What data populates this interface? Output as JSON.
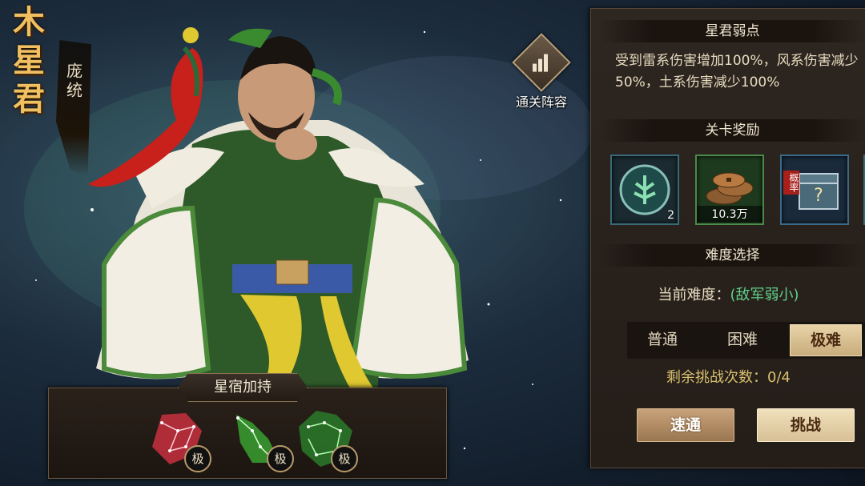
{
  "boss": {
    "title_chars": [
      "木",
      "星",
      "君"
    ],
    "hero_name": "庞统"
  },
  "formation": {
    "label": "通关阵容",
    "icon": "bar-chart-icon"
  },
  "panel": {
    "weakness_header": "星君弱点",
    "weakness_text": "受到雷系伤害增加100%，风系伤害减少50%，土系伤害减少100%",
    "rewards_header": "关卡奖励",
    "rewards": [
      {
        "icon": "tree-rune-icon",
        "count": "2"
      },
      {
        "icon": "copper-coins-icon",
        "count": "10.3万"
      },
      {
        "icon": "mystery-chest-icon",
        "tag": "概率"
      }
    ],
    "difficulty_header": "难度选择",
    "current_difficulty_label": "当前难度：",
    "current_difficulty_value": "(敌军弱小)",
    "tabs": [
      "普通",
      "困难",
      "极难"
    ],
    "active_tab": 2,
    "remaining_label": "剩余挑战次数：",
    "remaining_value": "0/4",
    "quick_clear_label": "速通",
    "challenge_label": "挑战"
  },
  "buffs": {
    "title": "星宿加持",
    "items": [
      {
        "icon": "red-beast-constellation-icon",
        "badge": "极",
        "color": "#d84050"
      },
      {
        "icon": "green-wolf-constellation-icon",
        "badge": "极",
        "color": "#50c040"
      },
      {
        "icon": "green-dragon-constellation-icon",
        "badge": "极",
        "color": "#40c050"
      }
    ]
  }
}
